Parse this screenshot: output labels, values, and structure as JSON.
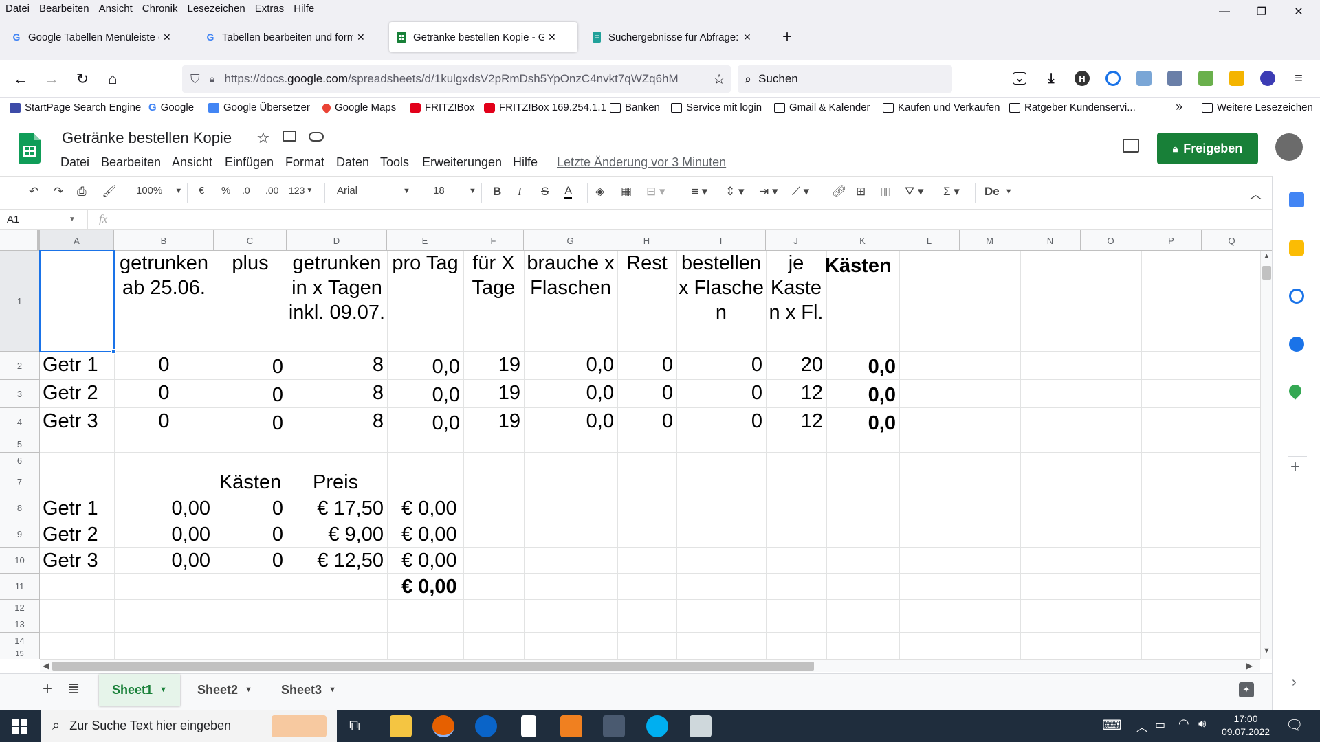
{
  "firefox_menu": [
    "Datei",
    "Bearbeiten",
    "Ansicht",
    "Chronik",
    "Lesezeichen",
    "Extras",
    "Hilfe"
  ],
  "window_controls": {
    "minimize": "—",
    "maximize": "❐",
    "close": "✕"
  },
  "tabs": [
    {
      "title": "Google Tabellen Menüleiste ein",
      "icon": "G",
      "active": false
    },
    {
      "title": "Tabellen bearbeiten und format",
      "icon": "G",
      "active": false
    },
    {
      "title": "Getränke bestellen Kopie - Goo",
      "icon": "sheets",
      "active": true
    },
    {
      "title": "Suchergebnisse für Abfrage: go",
      "icon": "doc",
      "active": false
    }
  ],
  "new_tab": "+",
  "nav": {
    "url_prefix": "https://docs.",
    "url_domain": "google.com",
    "url_rest": "/spreadsheets/d/1kulgxdsV2pRmDsh5YpOnzC4nvkt7qWZq6hM",
    "search_placeholder": "Suchen"
  },
  "bookmarks": [
    "StartPage Search Engine",
    "Google",
    "Google Übersetzer",
    "Google Maps",
    "FRITZ!Box",
    "FRITZ!Box 169.254.1.1",
    "Banken",
    "Service mit login",
    "Gmail & Kalender",
    "Kaufen und Verkaufen",
    "Ratgeber Kundenservi..."
  ],
  "more_bookmarks": "Weitere Lesezeichen",
  "sheets": {
    "title": "Getränke bestellen Kopie",
    "menu": [
      "Datei",
      "Bearbeiten",
      "Ansicht",
      "Einfügen",
      "Format",
      "Daten",
      "Tools",
      "Erweiterungen",
      "Hilfe"
    ],
    "last_edit": "Letzte Änderung vor 3 Minuten",
    "share_label": "Freigeben"
  },
  "toolbar": {
    "zoom": "100%",
    "currency": "€",
    "percent": "%",
    "dec_less": ".0",
    "dec_more": ".00",
    "number_format": "123",
    "font": "Arial",
    "font_size": "18",
    "bold": "B",
    "italic": "I",
    "strike": "S",
    "text_color": "A",
    "language_btn": "De"
  },
  "formula_bar": {
    "name_box": "A1",
    "fx": "fx",
    "content": ""
  },
  "columns": [
    "A",
    "B",
    "C",
    "D",
    "E",
    "F",
    "G",
    "H",
    "I",
    "J",
    "K",
    "L",
    "M",
    "N",
    "O",
    "P",
    "Q"
  ],
  "rows": [
    "1",
    "2",
    "3",
    "4",
    "5",
    "6",
    "7",
    "8",
    "9",
    "10",
    "11",
    "12",
    "13",
    "14",
    "15"
  ],
  "cells": {
    "B1": "getrunken ab 25.06.",
    "C1": "plus",
    "D1": "getrunken in x Tagen inkl. 09.07.",
    "E1": "pro Tag",
    "F1": "für X Tage",
    "G1": "brauche x Flaschen",
    "H1": "Rest",
    "I1": "bestellen x Flasche n",
    "J1": "je Kaste n x Fl.",
    "K1": "Kästen",
    "A2": "Getr 1",
    "B2": "0",
    "C2": "0",
    "D2": "8",
    "E2": "0,0",
    "F2": "19",
    "G2": "0,0",
    "H2": "0",
    "I2": "0",
    "J2": "20",
    "K2": "0,0",
    "A3": "Getr 2",
    "B3": "0",
    "C3": "0",
    "D3": "8",
    "E3": "0,0",
    "F3": "19",
    "G3": "0,0",
    "H3": "0",
    "I3": "0",
    "J3": "12",
    "K3": "0,0",
    "A4": "Getr 3",
    "B4": "0",
    "C4": "0",
    "D4": "8",
    "E4": "0,0",
    "F4": "19",
    "G4": "0,0",
    "H4": "0",
    "I4": "0",
    "J4": "12",
    "K4": "0,0",
    "C7": "Kästen",
    "D7": "Preis",
    "A8": "Getr 1",
    "B8": "0,00",
    "C8": "0",
    "D8": "€ 17,50",
    "E8": "€ 0,00",
    "A9": "Getr 2",
    "B9": "0,00",
    "C9": "0",
    "D9": "€ 9,00",
    "E9": "€ 0,00",
    "A10": "Getr 3",
    "B10": "0,00",
    "C10": "0",
    "D10": "€ 12,50",
    "E10": "€ 0,00",
    "E11": "€ 0,00"
  },
  "sheet_tabs": [
    "Sheet1",
    "Sheet2",
    "Sheet3"
  ],
  "active_sheet": "Sheet1",
  "taskbar": {
    "search_placeholder": "Zur Suche Text hier eingeben",
    "time": "17:00",
    "date": "09.07.2022"
  },
  "colors": {
    "sheets_green": "#188038",
    "selection_blue": "#1a73e8",
    "taskbar": "#1f2d3d"
  }
}
